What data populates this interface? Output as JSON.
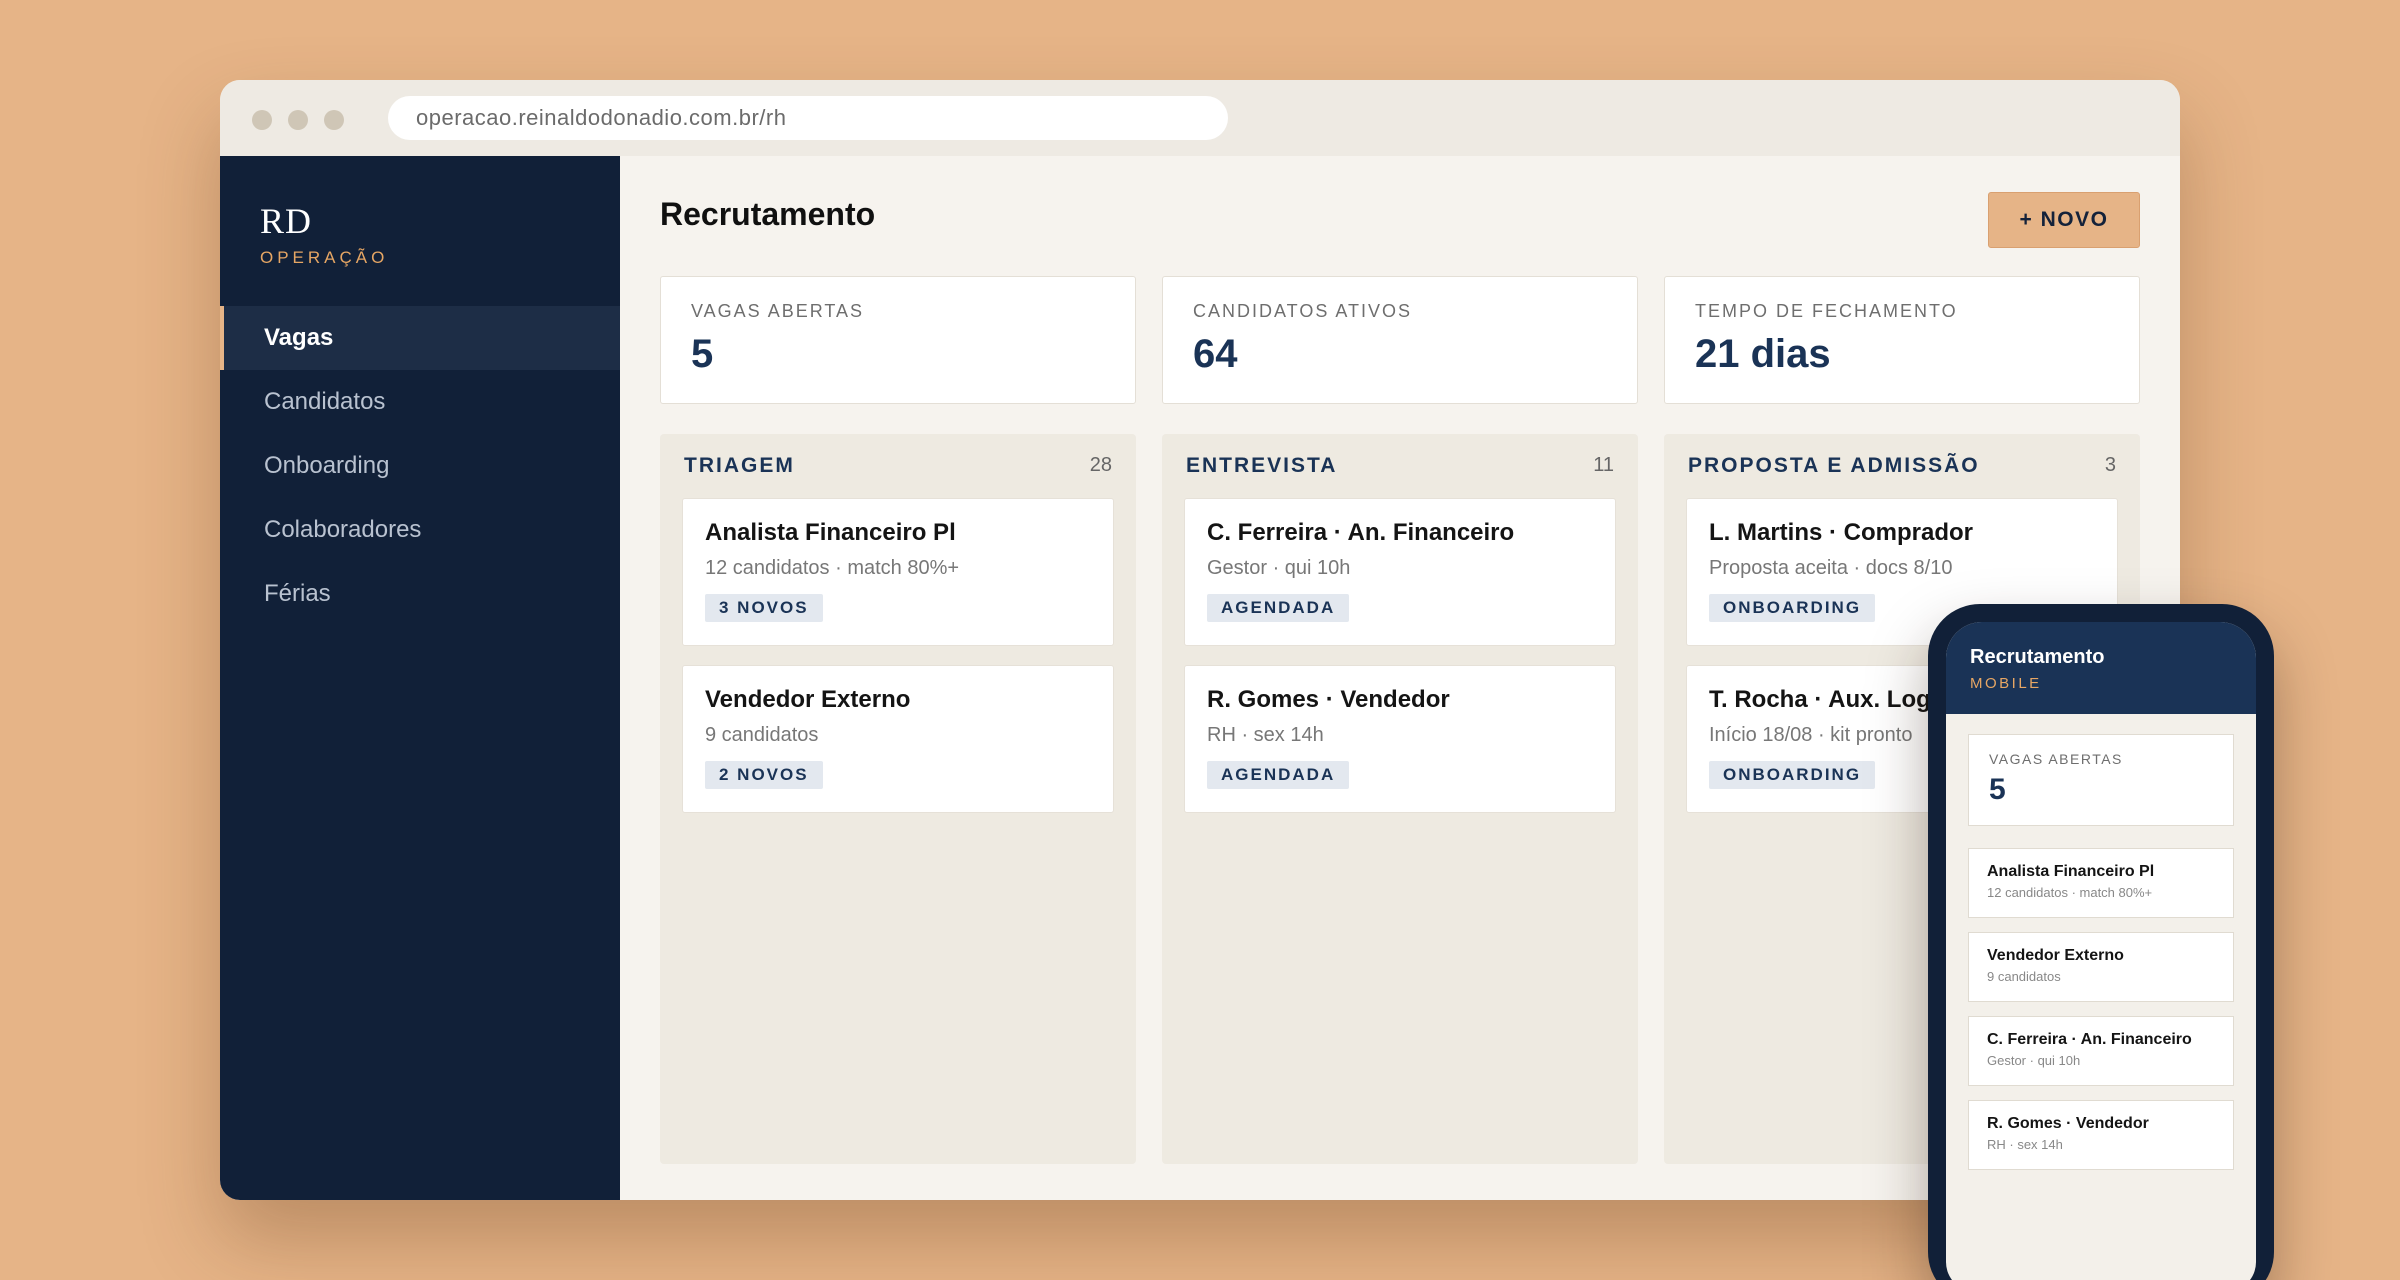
{
  "browser": {
    "url": "operacao.reinaldodonadio.com.br/rh"
  },
  "sidebar": {
    "brand_mark": "RD",
    "brand_sub": "OPERAÇÃO",
    "items": [
      {
        "label": "Vagas",
        "active": true
      },
      {
        "label": "Candidatos",
        "active": false
      },
      {
        "label": "Onboarding",
        "active": false
      },
      {
        "label": "Colaboradores",
        "active": false
      },
      {
        "label": "Férias",
        "active": false
      }
    ]
  },
  "main": {
    "title": "Recrutamento",
    "new_button": "+ NOVO",
    "kpis": [
      {
        "label": "VAGAS ABERTAS",
        "value": "5"
      },
      {
        "label": "CANDIDATOS ATIVOS",
        "value": "64"
      },
      {
        "label": "TEMPO DE FECHAMENTO",
        "value": "21 dias"
      }
    ],
    "columns": [
      {
        "title": "TRIAGEM",
        "count": "28",
        "cards": [
          {
            "title": "Analista Financeiro Pl",
            "sub": "12 candidatos · match 80%+",
            "badge": "3 NOVOS"
          },
          {
            "title": "Vendedor Externo",
            "sub": "9 candidatos",
            "badge": "2 NOVOS"
          }
        ]
      },
      {
        "title": "ENTREVISTA",
        "count": "11",
        "cards": [
          {
            "title": "C. Ferreira · An. Financeiro",
            "sub": "Gestor · qui 10h",
            "badge": "AGENDADA"
          },
          {
            "title": "R. Gomes · Vendedor",
            "sub": "RH · sex 14h",
            "badge": "AGENDADA"
          }
        ]
      },
      {
        "title": "PROPOSTA E ADMISSÃO",
        "count": "3",
        "cards": [
          {
            "title": "L. Martins · Comprador",
            "sub": "Proposta aceita · docs 8/10",
            "badge": "ONBOARDING"
          },
          {
            "title": "T. Rocha · Aux. Logí",
            "sub": "Início 18/08 · kit pronto",
            "badge": "ONBOARDING"
          }
        ]
      }
    ]
  },
  "mobile": {
    "title": "Recrutamento",
    "sub": "MOBILE",
    "kpi": {
      "label": "VAGAS ABERTAS",
      "value": "5"
    },
    "cards": [
      {
        "title": "Analista Financeiro Pl",
        "sub": "12 candidatos · match 80%+"
      },
      {
        "title": "Vendedor Externo",
        "sub": "9 candidatos"
      },
      {
        "title": "C. Ferreira · An. Financeiro",
        "sub": "Gestor · qui 10h"
      },
      {
        "title": "R. Gomes · Vendedor",
        "sub": "RH · sex 14h"
      }
    ]
  },
  "colors": {
    "background": "#e6b487",
    "navy": "#112038",
    "accent": "#e6b487",
    "brand_accent": "#e6a664",
    "value_blue": "#1a3356"
  }
}
